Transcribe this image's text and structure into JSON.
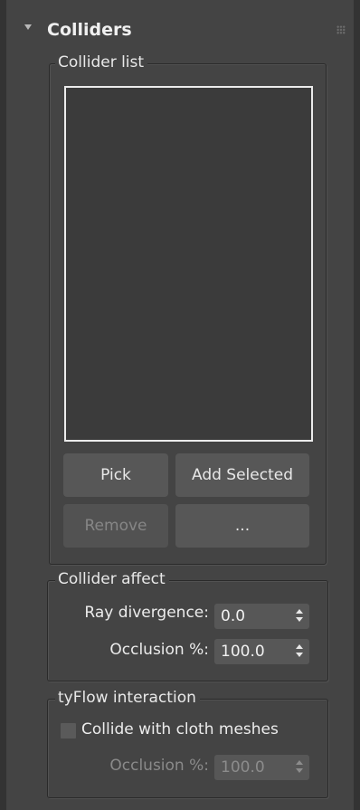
{
  "rollout": {
    "title": "Colliders"
  },
  "collider_list": {
    "group_label": "Collider list",
    "items": [],
    "buttons": {
      "pick": "Pick",
      "add_selected": "Add Selected",
      "remove": "Remove",
      "more": "..."
    }
  },
  "collider_affect": {
    "group_label": "Collider affect",
    "ray_divergence_label": "Ray divergence:",
    "ray_divergence_value": "0.0",
    "occlusion_label": "Occlusion %:",
    "occlusion_value": "100.0"
  },
  "tyflow_interaction": {
    "group_label": "tyFlow interaction",
    "collide_cloth_label": "Collide with cloth meshes",
    "collide_cloth_checked": false,
    "occlusion_label": "Occlusion %:",
    "occlusion_value": "100.0"
  },
  "icons": {
    "collapse": "triangle-down",
    "grip": "dotted-grip",
    "spinner": "up-down-arrows"
  }
}
